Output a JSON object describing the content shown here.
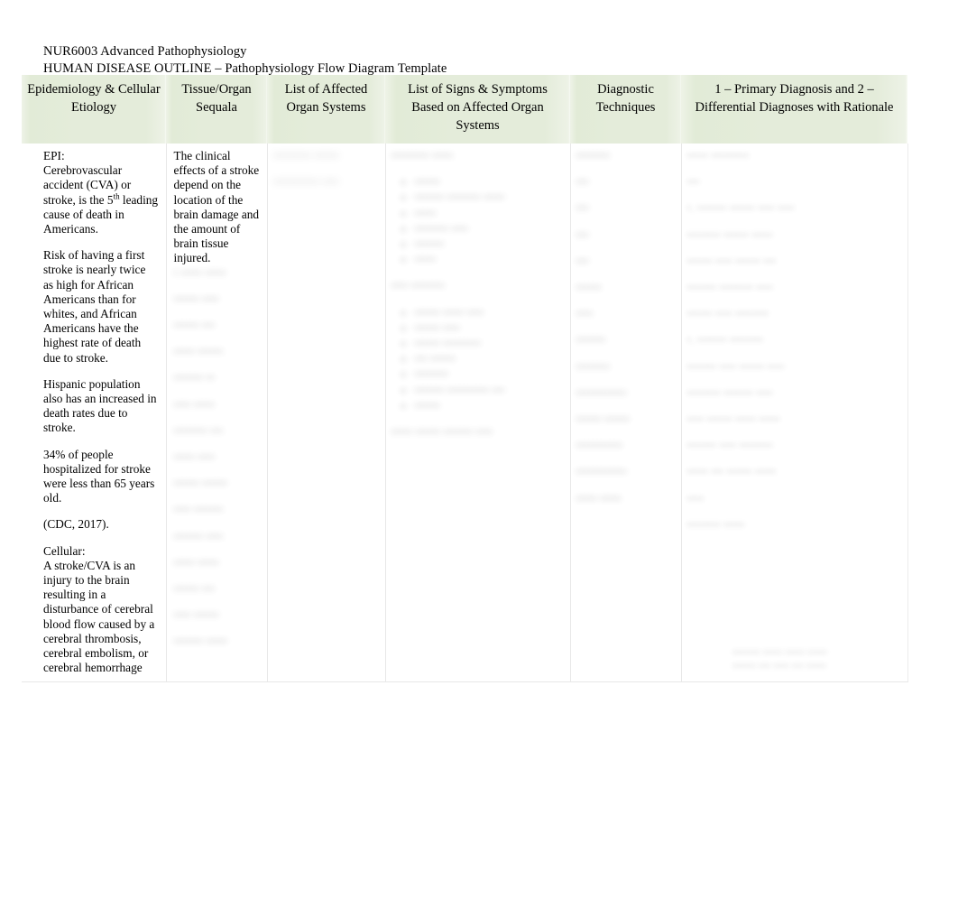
{
  "document": {
    "course_line": "NUR6003 Advanced Pathophysiology",
    "title_line": "HUMAN DISEASE OUTLINE – Pathophysiology Flow Diagram Template"
  },
  "colors": {
    "header_band": "#e4ecda",
    "page_background": "#ffffff",
    "text": "#000000",
    "grid_line": "#e8e8e8"
  },
  "table": {
    "headers": [
      "Epidemiology & Cellular Etiology",
      "Tissue/Organ Sequala",
      "List of Affected Organ Systems",
      "List of Signs & Symptoms Based on Affected Organ Systems",
      "Diagnostic Techniques",
      "1 – Primary Diagnosis and 2 – Differential Diagnoses with Rationale"
    ],
    "columns": {
      "epidemiology": {
        "label": "Epidemiology & Cellular Etiology",
        "paragraphs": [
          "EPI:",
          "Cerebrovascular accident (CVA) or stroke, is the 5",
          "th",
          " leading cause of death in Americans.",
          "Risk of having a first stroke is nearly twice as high for African Americans than for whites, and African Americans have the highest rate of death due to stroke.",
          "Hispanic population also has an increased in death rates due to stroke.",
          "34% of people hospitalized for stroke were less than 65 years old.",
          "(CDC, 2017).",
          "Cellular:",
          "A stroke/CVA is an injury to the brain resulting in a disturbance of cerebral blood flow caused by a cerebral thrombosis, cerebral embolism, or cerebral hemorrhage"
        ],
        "epi_label": "EPI:",
        "epi_sentence_before_sup": "Cerebrovascular accident (CVA) or stroke, is the 5",
        "epi_sup": "th",
        "epi_sentence_after_sup": " leading cause of death in Americans.",
        "risk_paragraph": "Risk of having a first stroke is nearly twice as high for African Americans than for whites, and African Americans have the highest rate of death due to stroke.",
        "hispanic_paragraph": "Hispanic population also has an increased in death rates due to stroke.",
        "hospitalized_paragraph": "34% of people hospitalized for stroke were less than 65 years old.",
        "citation": "(CDC, 2017).",
        "cellular_label": "Cellular:",
        "cellular_paragraph": "A stroke/CVA is an injury to the brain resulting in a disturbance of cerebral blood flow caused by a cerebral thrombosis, cerebral embolism, or cerebral hemorrhage"
      },
      "tissue_organ_sequala": {
        "label": "Tissue/Organ Sequala",
        "visible_paragraph": "The clinical effects of a stroke depend on the location of the brain damage and the amount of brain tissue injured.",
        "obscured": true,
        "obscured_note": "Remaining cell content is blurred and illegible in the screenshot.",
        "obscured_lines": [
          "• ••••• •••••",
          "•••••• ••••",
          "•••••• •••",
          "••••• ••••••",
          "••••••• ••",
          "•••• •••••",
          "•••••••• •••",
          "••••• ••••",
          "•••••• ••••••",
          "•••• •••••••",
          "••••••• ••••",
          "••••• •••••",
          "•••••• •••",
          "•••• ••••••",
          "••••••• •••••"
        ]
      },
      "affected_organ_systems": {
        "label": "List of Affected Organ Systems",
        "obscured": true,
        "obscured_note": "Cell content is blurred and illegible in the screenshot.",
        "obscured_lines": [
          "••••••••• ••••••",
          "••••••••••• ••••"
        ]
      },
      "signs_and_symptoms": {
        "label": "List of Signs & Symptoms Based on Affected Organ Systems",
        "obscured": true,
        "obscured_note": "Cell content is blurred and illegible in the screenshot.",
        "obscured_groups": [
          {
            "heading": "••••••••• •••••",
            "items": [
              "••••••",
              "••••••• •••••••• •••••",
              "•••••",
              "•••••••• ••••",
              "•••••••",
              "•••••"
            ]
          },
          {
            "heading": "•••• ••••••••",
            "items": [
              "•••••• ••••• ••••",
              "•••••• ••••",
              "•••••• •••••••••",
              "••• ••••••",
              "••••••••",
              "••••••• •••••••••• •••",
              "••••••"
            ]
          }
        ],
        "obscured_footer": "••••• •••••• ••••••• ••••"
      },
      "diagnostic_techniques": {
        "label": "Diagnostic Techniques",
        "obscured": true,
        "obscured_note": "Cell content is blurred and illegible in the screenshot.",
        "obscured_lines": [
          "••••••••",
          "•••",
          "•••",
          "•••",
          "•••",
          "••••••",
          "••••",
          "•••••••",
          "••••••••",
          "••••••••••••",
          "•••••• ••••••",
          "•••••••••••",
          "••••••••••••",
          "••••• •••••"
        ]
      },
      "diagnoses": {
        "label": "1 – Primary Diagnosis and 2 – Differential Diagnoses with Rationale",
        "obscured": true,
        "obscured_note": "Cell content is blurred and illegible in the screenshot.",
        "obscured_lines": [
          "••••• •••••••••",
          "•••",
          "•. ••••••• •••••• •••• ••••",
          "•••••••• •••••• •••••",
          "•••••• •••• •••••• •••",
          "••••••• •••••••• ••••",
          "•••••• •••• ••••••••",
          "•. ••••••• ••••••••",
          "••••••• •••• •••••• ••••",
          "•••••••• ••••••• ••••",
          "•••• •••••• ••••• •••••",
          "••••••• •••• ••••••••",
          "••••• ••• •••••• •••••",
          "••••"
        ],
        "obscured_citation": "•••••••• •••••"
      }
    }
  },
  "footer": {
    "obscured": true,
    "obscured_note": "Footer text below the table is blurred and illegible in the screenshot.",
    "obscured_lines": [
      "••••••• ••••• ••••• •••••",
      "•••••• ••• •••• ••• •••••"
    ]
  }
}
